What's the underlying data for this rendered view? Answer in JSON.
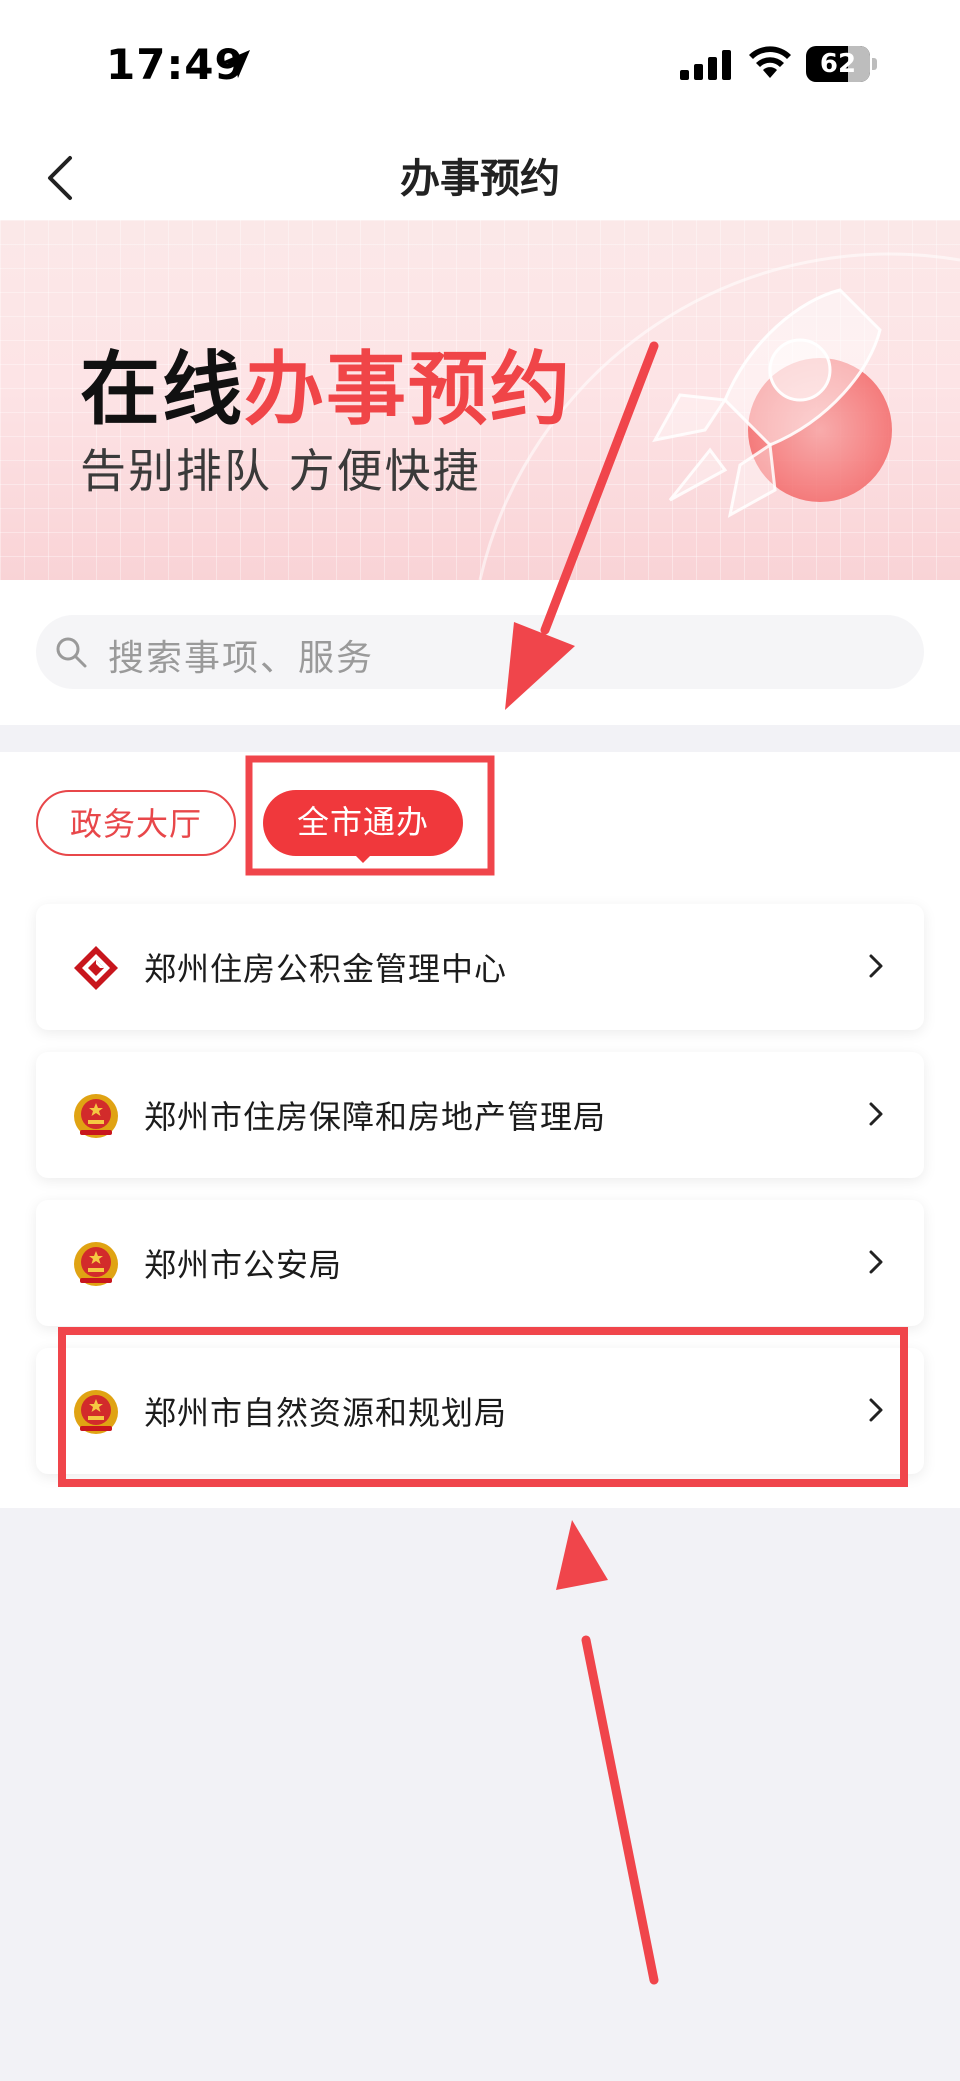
{
  "status_bar": {
    "time": "17:49",
    "battery": "62"
  },
  "nav": {
    "title": "办事预约"
  },
  "banner": {
    "title_black": "在线",
    "title_red": "办事预约",
    "subtitle": "告别排队 方便快捷"
  },
  "search": {
    "placeholder": "搜索事项、服务"
  },
  "tabs": [
    {
      "label": "政务大厅",
      "active": false
    },
    {
      "label": "全市通办",
      "active": true
    }
  ],
  "list": [
    {
      "label": "郑州住房公积金管理中心",
      "icon": "housing-fund-logo-icon"
    },
    {
      "label": "郑州市住房保障和房地产管理局",
      "icon": "national-emblem-icon"
    },
    {
      "label": "郑州市公安局",
      "icon": "national-emblem-icon"
    },
    {
      "label": "郑州市自然资源和规划局",
      "icon": "national-emblem-icon"
    }
  ],
  "colors": {
    "accent": "#f0383c",
    "annotation": "#f0454b",
    "page_bg": "#f2f2f6"
  }
}
